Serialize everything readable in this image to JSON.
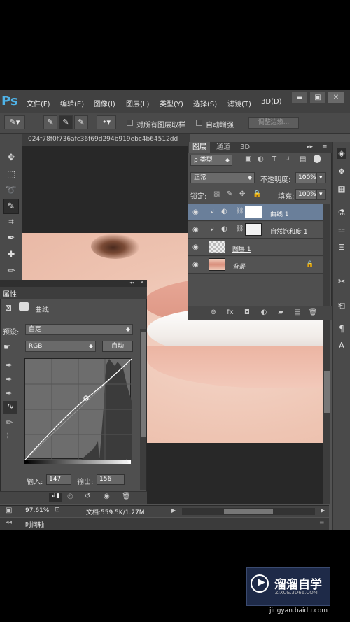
{
  "app": {
    "logo": "Ps"
  },
  "menus": [
    "文件(F)",
    "编辑(E)",
    "图像(I)",
    "图层(L)",
    "类型(Y)",
    "选择(S)",
    "滤镜(T)",
    "3D(D)"
  ],
  "window_controls": {
    "minimize": "▬",
    "maximize": "▣",
    "close": "✕"
  },
  "options_bar": {
    "sample_all_layers": "对所有图层取样",
    "auto_enhance": "自动增强",
    "refine_edge": "调整边缘..."
  },
  "document": {
    "tab_title": "024f78f0f736afc36f69d294b919ebc4b64512dd"
  },
  "layers_panel": {
    "tabs": [
      "图层",
      "通道",
      "3D"
    ],
    "filter_kind": "ρ 类型",
    "blend_mode": "正常",
    "opacity_label": "不透明度:",
    "opacity_value": "100%",
    "lock_label": "锁定:",
    "fill_label": "填充:",
    "fill_value": "100%",
    "layers": [
      {
        "name": "曲线 1",
        "type": "adjustment",
        "selected": true
      },
      {
        "name": "自然饱和度 1",
        "type": "adjustment",
        "selected": false
      },
      {
        "name": "图层 1",
        "type": "pixel",
        "selected": false
      },
      {
        "name": "背景",
        "type": "background",
        "locked": true,
        "selected": false
      }
    ],
    "footer_icons": [
      "link-icon",
      "fx-icon",
      "mask-icon",
      "adjustment-icon",
      "folder-icon",
      "new-layer-icon",
      "trash-icon"
    ],
    "footer_labels": {
      "link": "⊖",
      "fx": "fx",
      "mask": "◘",
      "adjust": "◐",
      "folder": "▰",
      "new": "▤",
      "trash": "🗑"
    }
  },
  "properties_panel": {
    "title": "属性",
    "adjustment_name": "曲线",
    "preset_label": "预设:",
    "preset_value": "自定",
    "channel": "RGB",
    "auto_button": "自动",
    "input_label": "输入:",
    "input_value": "147",
    "output_label": "输出:",
    "output_value": "156",
    "curve_point": {
      "input": 147,
      "output": 156
    }
  },
  "status_bar": {
    "zoom": "97.61%",
    "doc_size": "文档:559.5K/1.27M"
  },
  "timeline": {
    "label": "时间轴"
  },
  "watermark": {
    "brand": "溜溜自学",
    "brand_sub": "ZIXUE.3D66.COM",
    "site": "jingyan.baidu.com"
  }
}
